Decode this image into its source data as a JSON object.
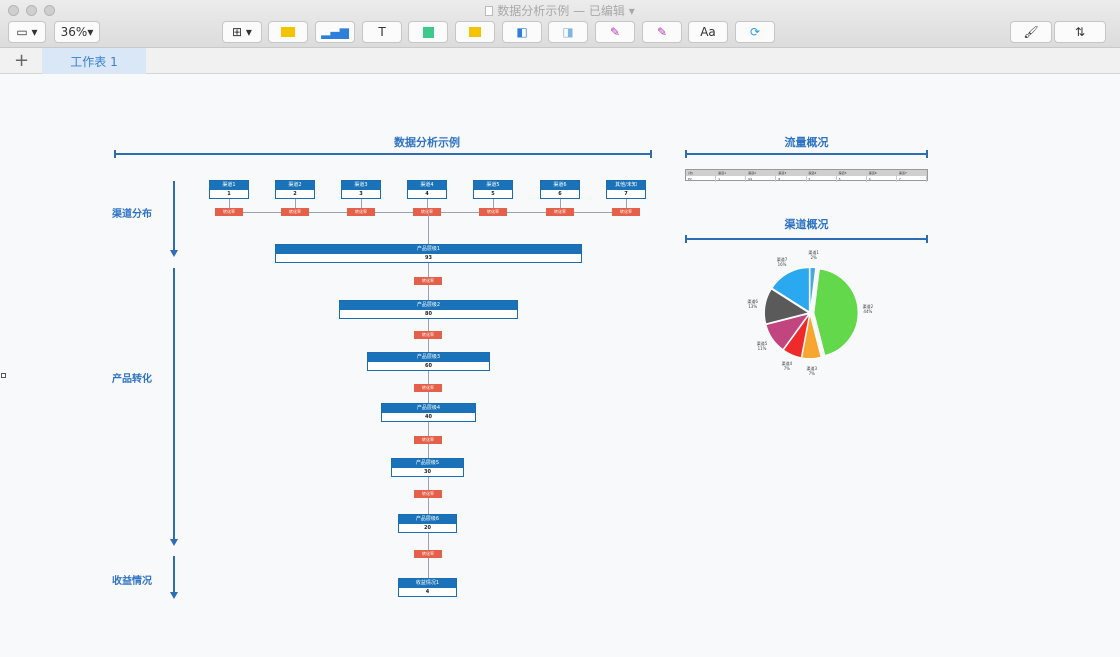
{
  "window": {
    "title": "数据分析示例",
    "status": "— 已编辑"
  },
  "toolbar": {
    "zoom": "36%",
    "text_tool": "T",
    "format_tool": "Aa"
  },
  "tabs": [
    {
      "label": "工作表 1"
    }
  ],
  "headers": {
    "main": "数据分析示例",
    "traffic": "流量概况",
    "channel": "渠道概况"
  },
  "sections": {
    "channel": "渠道分布",
    "product": "产品转化",
    "revenue": "收益情况"
  },
  "conversion_label": "转化率",
  "channels": [
    {
      "name": "渠道1",
      "value": "1"
    },
    {
      "name": "渠道2",
      "value": "2"
    },
    {
      "name": "渠道3",
      "value": "3"
    },
    {
      "name": "渠道4",
      "value": "4"
    },
    {
      "name": "渠道5",
      "value": "5"
    },
    {
      "name": "渠道6",
      "value": "6"
    },
    {
      "name": "其他/未知",
      "value": "7"
    }
  ],
  "funnel": [
    {
      "name": "产品层级1",
      "value": "93"
    },
    {
      "name": "产品层级2",
      "value": "80"
    },
    {
      "name": "产品层级3",
      "value": "60"
    },
    {
      "name": "产品层级4",
      "value": "40"
    },
    {
      "name": "产品层级5",
      "value": "30"
    },
    {
      "name": "产品层级6",
      "value": "20"
    },
    {
      "name": "收益情况1",
      "value": "4"
    }
  ],
  "traffic_table": {
    "header": [
      "(次)",
      "渠道1",
      "渠道2",
      "渠道3",
      "渠道4",
      "渠道5",
      "渠道6",
      "渠道7"
    ],
    "row": [
      "PV",
      "1",
      "64",
      "8",
      "5",
      "5",
      "4",
      "7"
    ]
  },
  "chart_data": {
    "type": "pie",
    "title": "",
    "slices": [
      {
        "label": "渠道1",
        "value": 2,
        "pct": "2%",
        "color": "#4aa8e0"
      },
      {
        "label": "渠道2",
        "value": 44,
        "pct": "44%",
        "color": "#62d84a"
      },
      {
        "label": "渠道3",
        "value": 7,
        "pct": "7%",
        "color": "#f7a631"
      },
      {
        "label": "渠道4",
        "value": 7,
        "pct": "7%",
        "color": "#ee2a2a"
      },
      {
        "label": "渠道5",
        "value": 11,
        "pct": "11%",
        "color": "#c1457f"
      },
      {
        "label": "渠道6",
        "value": 13,
        "pct": "13%",
        "color": "#5a5a5a"
      },
      {
        "label": "渠道7",
        "value": 16,
        "pct": "16%",
        "color": "#2aa9f0"
      }
    ]
  }
}
